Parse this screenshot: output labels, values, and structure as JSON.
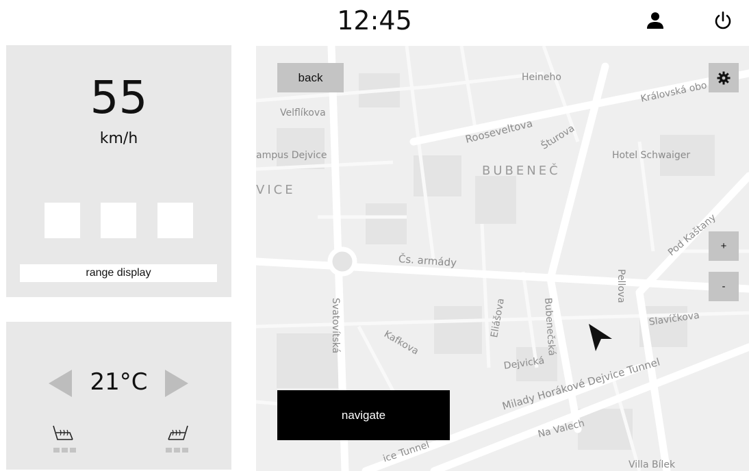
{
  "header": {
    "clock": "12:45",
    "profile_icon": "person-icon",
    "power_icon": "power-icon"
  },
  "speed_panel": {
    "speed": "55",
    "unit": "km/h",
    "indicator_count": 3,
    "range_label": "range display"
  },
  "climate_panel": {
    "temperature": "21°C",
    "decrease_icon": "triangle-left-icon",
    "increase_icon": "triangle-right-icon",
    "left_seat_icon": "heated-seat-left-icon",
    "right_seat_icon": "heated-seat-right-icon"
  },
  "map": {
    "back_label": "back",
    "settings_icon": "gear-icon",
    "zoom_in_label": "+",
    "zoom_out_label": "-",
    "navigate_label": "navigate",
    "position_icon": "navigation-arrow-icon",
    "labels": {
      "heineho": "Heineho",
      "kralovska": "Královská obo",
      "velflikova": "Velflíkova",
      "roosevelt": "Rooseveltova",
      "sturova": "Šturova",
      "campus": "ampus Dejvice",
      "hotel": "Hotel Schwaiger",
      "bubenec": "BUBENEČ",
      "vice": "VICE",
      "pod_kastany": "Pod Kaštany",
      "pellova": "Pellova",
      "cs_armady": "Čs. armády",
      "svatovitska": "Svatovítská",
      "eliasova": "Eliášova",
      "bubenecska": "Bubenečská",
      "kafkova": "Kafkova",
      "slavickova": "Slavíčkova",
      "dejvicka": "Dejvická",
      "tunnel": "Milady Horákové Dejvice Tunnel",
      "na_valech": "Na Valech",
      "tunnel_bottom": "ice Tunnel",
      "villa": "Villa Bílek"
    }
  }
}
